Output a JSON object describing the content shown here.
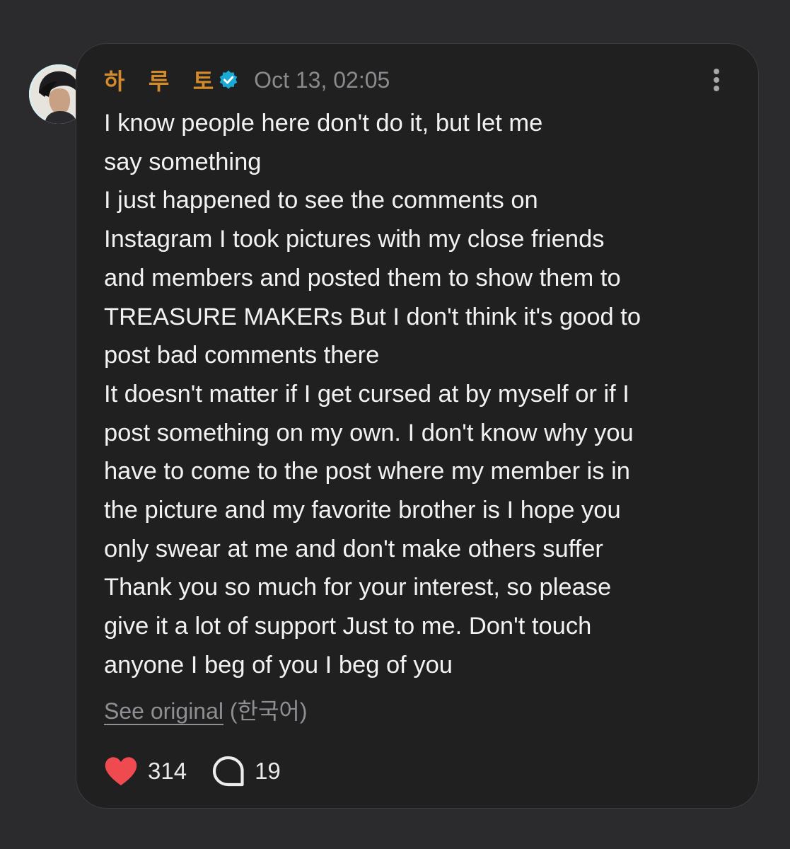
{
  "post": {
    "author": {
      "name": "하   루   토",
      "verified": true,
      "verified_color": "#1ba9d6",
      "name_color": "#d38a2b",
      "avatar_icon": "avatar"
    },
    "timestamp": "Oct 13, 02:05",
    "menu_icon": "more-vertical-icon",
    "body_lines": [
      "I know people here don't do it, but let me",
      "say something",
      "I just happened to see the comments on",
      "Instagram I took pictures with my close friends",
      "and members and posted them to show them to",
      "TREASURE MAKERs But I don't think it's good to",
      "post bad comments there",
      "It doesn't matter if I get cursed at by myself or if I",
      "post something on my own. I don't know why you",
      "have to come to the post where my member is in",
      "the picture and my favorite brother is I hope you",
      "only swear at me and don't make others suffer",
      "Thank you so much for your interest, so please",
      "give it a lot of support Just to me. Don't touch",
      "anyone I beg of you I beg of you"
    ],
    "see_original_label": "See original",
    "original_language": "(한국어)",
    "likes": {
      "icon": "heart-icon",
      "count": "314",
      "color": "#ef4a4f"
    },
    "comments": {
      "icon": "comment-bubble-icon",
      "count": "19"
    }
  },
  "colors": {
    "background": "#2b2b2d",
    "card": "#202021",
    "text": "#f2f2f2",
    "muted": "#8b8b8f"
  }
}
